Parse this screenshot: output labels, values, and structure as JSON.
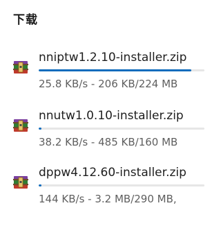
{
  "panel": {
    "title": "下载"
  },
  "downloads": [
    {
      "filename": "nniptw1.2.10-installer.zip",
      "status": "25.8 KB/s - 206 KB/224 MB",
      "progress": 0.92,
      "icon": "winrar-archive-icon"
    },
    {
      "filename": "nnutw1.0.10-installer.zip",
      "status": "38.2 KB/s - 485 KB/160 MB",
      "progress": 0.003,
      "icon": "winrar-archive-icon"
    },
    {
      "filename": "dppw4.12.60-installer.zip",
      "status": "144 KB/s - 3.2 MB/290 MB,",
      "progress": 0.011,
      "icon": "winrar-archive-icon"
    }
  ],
  "colors": {
    "accent": "#0f6cbd",
    "track": "#e6e6e6",
    "text": "#1e1e1e",
    "secondary": "#5f5f5f"
  }
}
